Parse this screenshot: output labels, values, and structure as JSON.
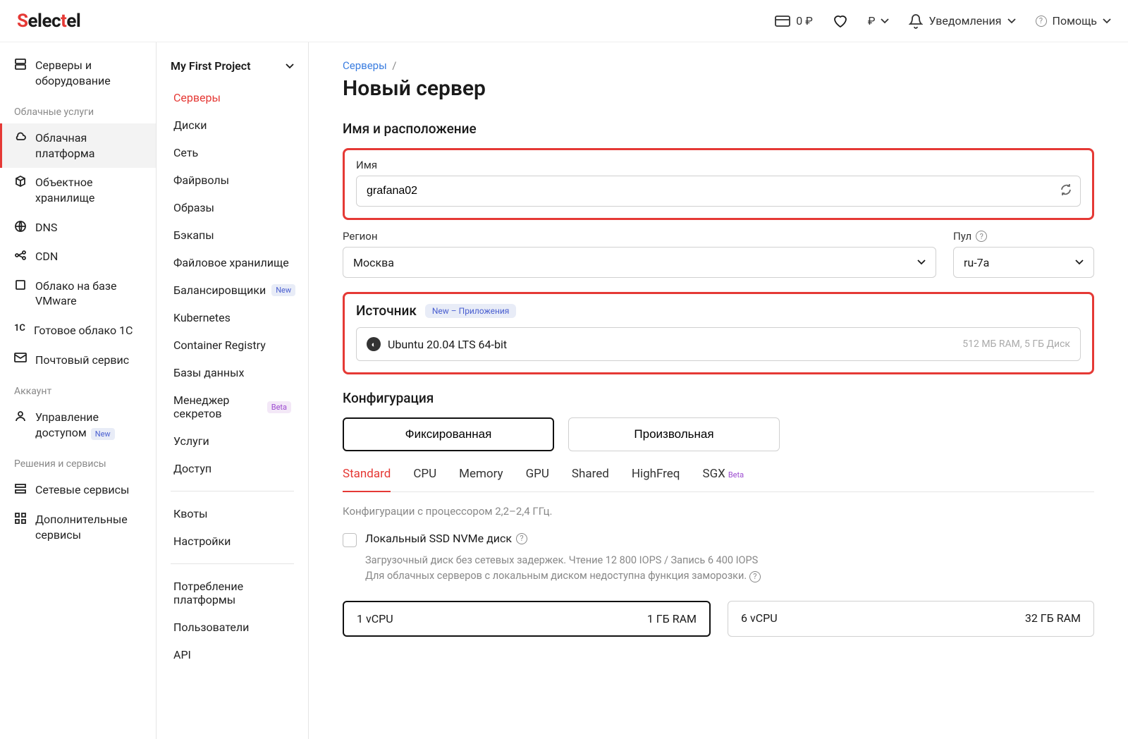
{
  "header": {
    "balance": "0 ₽",
    "currency": "₽",
    "notifications": "Уведомления",
    "help": "Помощь"
  },
  "sidebar1": {
    "servers": "Серверы и оборудование",
    "group_cloud": "Облачные услуги",
    "cloud_platform": "Облачная платформа",
    "object_storage": "Объектное хранилище",
    "dns": "DNS",
    "cdn": "CDN",
    "vmware": "Облако на базе VMware",
    "onec": "Готовое облако 1С",
    "mail": "Почтовый сервис",
    "group_account": "Аккаунт",
    "access_mgmt": "Управление доступом",
    "access_new": "New",
    "group_solutions": "Решения и сервисы",
    "net_services": "Сетевые сервисы",
    "addl_services": "Дополнительные сервисы"
  },
  "sidebar2": {
    "project": "My First Project",
    "servers": "Серверы",
    "disks": "Диски",
    "network": "Сеть",
    "firewalls": "Файрволы",
    "images": "Образы",
    "backups": "Бэкапы",
    "file_storage": "Файловое хранилище",
    "balancers": "Балансировщики",
    "balancers_new": "New",
    "kubernetes": "Kubernetes",
    "container_registry": "Container Registry",
    "databases": "Базы данных",
    "secrets": "Менеджер секретов",
    "secrets_beta": "Beta",
    "services": "Услуги",
    "access": "Доступ",
    "quotas": "Квоты",
    "settings": "Настройки",
    "consumption": "Потребление платформы",
    "users": "Пользователи",
    "api": "API"
  },
  "main": {
    "crumb_servers": "Серверы",
    "title": "Новый сервер",
    "sec_name_loc": "Имя и расположение",
    "lbl_name": "Имя",
    "name_value": "grafana02",
    "lbl_region": "Регион",
    "region_value": "Москва",
    "lbl_pool": "Пул",
    "pool_value": "ru-7a",
    "sec_source": "Источник",
    "source_badge": "New – Приложения",
    "source_value": "Ubuntu 20.04 LTS 64-bit",
    "source_hint": "512 МБ RAM, 5 ГБ Диск",
    "sec_config": "Конфигурация",
    "seg_fixed": "Фиксированная",
    "seg_free": "Произвольная",
    "tabs": {
      "standard": "Standard",
      "cpu": "CPU",
      "memory": "Memory",
      "gpu": "GPU",
      "shared": "Shared",
      "highfreq": "HighFreq",
      "sgx": "SGX",
      "sgx_beta": "Beta"
    },
    "cfg_note": "Конфигурации с процессором 2,2–2,4 ГГц.",
    "chk_label": "Локальный SSD NVMe диск",
    "chk_desc1": "Загрузочный диск без сетевых задержек. Чтение 12 800 IOPS / Запись 6 400 IOPS",
    "chk_desc2": "Для облачных серверов с локальным диском недоступна функция заморозки.",
    "card1_cpu": "1 vCPU",
    "card1_ram": "1 ГБ RAM",
    "card2_cpu": "6 vCPU",
    "card2_ram": "32 ГБ RAM"
  }
}
